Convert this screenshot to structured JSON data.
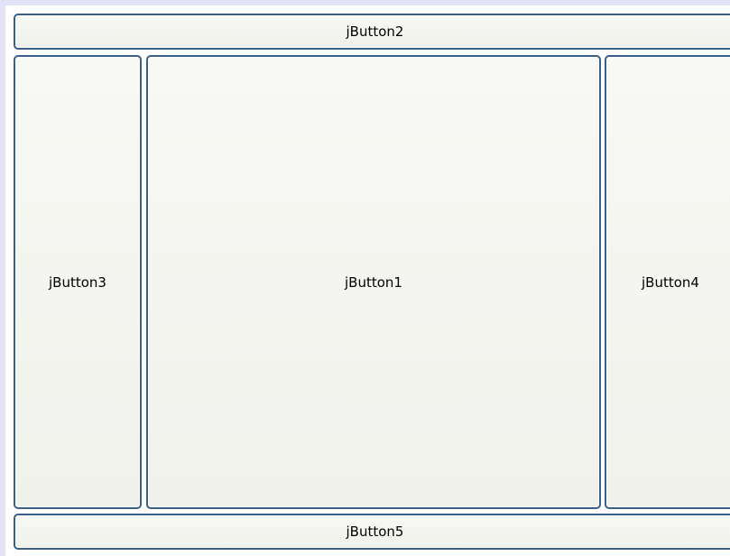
{
  "buttons": {
    "north": "jButton2",
    "west": "jButton3",
    "center": "jButton1",
    "east": "jButton4",
    "south": "jButton5"
  },
  "colors": {
    "window_background": "#e3e3f8",
    "button_border": "#3b5f86",
    "button_face": "#f5f5f0"
  }
}
